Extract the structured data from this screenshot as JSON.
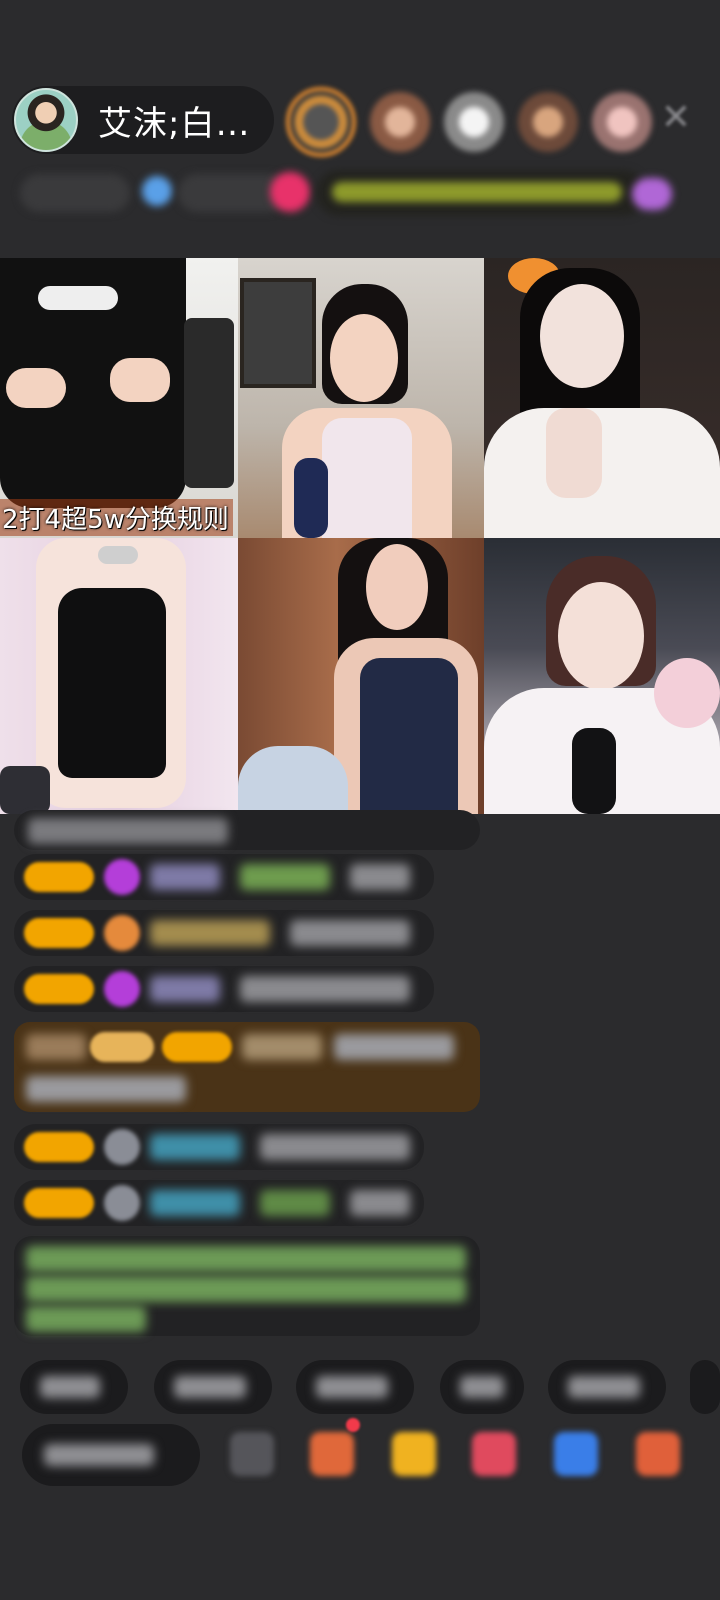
{
  "header": {
    "host_name": "艾沫;白…",
    "close_icon": "close-icon"
  },
  "grid": {
    "tile1_caption": "2打4超5w分换规则"
  },
  "colors": {
    "background": "#2b2b2d",
    "level_badge": "#f2a500",
    "highlight_row": "#4a3317",
    "green_text": "#8ec27a",
    "cyan_text": "#53b9d6"
  }
}
